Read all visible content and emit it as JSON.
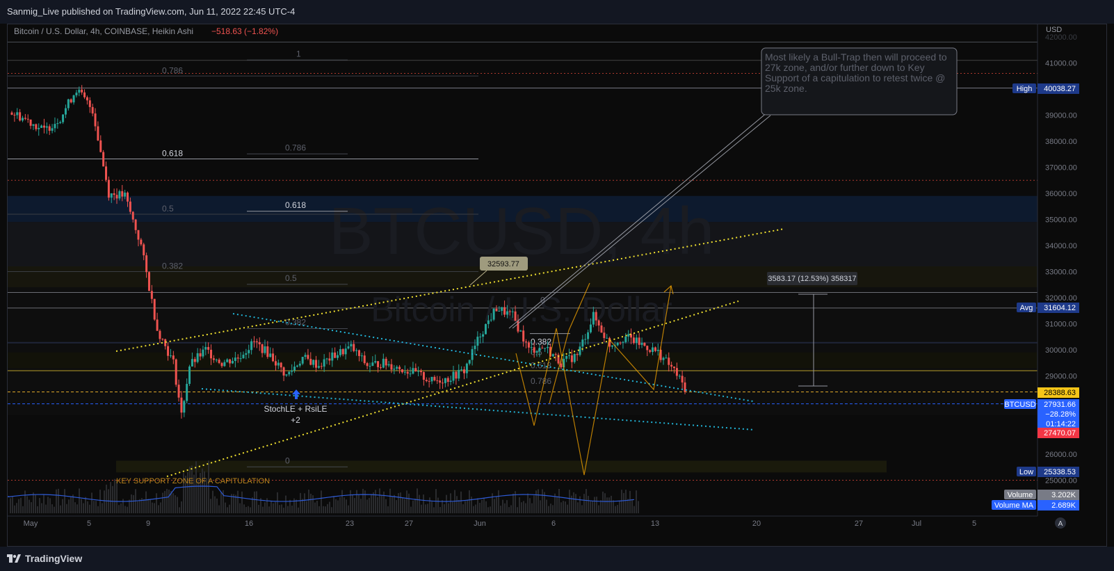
{
  "header": {
    "published": "Sanmig_Live published on TradingView.com, Jun 11, 2022 22:45 UTC-4"
  },
  "footer": {
    "brand": "TradingView"
  },
  "chart_data": {
    "type": "candlestick",
    "symbol_line": "Bitcoin / U.S. Dollar, 4h, COINBASE, Heikin Ashi",
    "change_text": "−518.63 (−1.82%)",
    "watermark": {
      "title": "BTCUSD, 4h",
      "subtitle": "Bitcoin / U.S. Dollar"
    },
    "currency": "USD",
    "ylim": [
      24500,
      42000
    ],
    "yticks": [
      25000,
      26000,
      27000,
      28000,
      29000,
      30000,
      31000,
      32000,
      33000,
      34000,
      35000,
      36000,
      37000,
      38000,
      39000,
      40000,
      41000,
      42000
    ],
    "ytick_labels": [
      "25000.00",
      "26000.00",
      "27000.00",
      "28000.00",
      "29000.00",
      "30000.00",
      "31000.00",
      "32000.00",
      "33000.00",
      "34000.00",
      "35000.00",
      "36000.00",
      "37000.00",
      "38000.00",
      "39000.00",
      "40000.00",
      "41000.00",
      "42000.00"
    ],
    "xticks": [
      {
        "label": "May",
        "day": 0
      },
      {
        "label": "5",
        "day": 4
      },
      {
        "label": "9",
        "day": 8
      },
      {
        "label": "16",
        "day": 15
      },
      {
        "label": "23",
        "day": 22
      },
      {
        "label": "27",
        "day": 26
      },
      {
        "label": "Jun",
        "day": 31
      },
      {
        "label": "6",
        "day": 36
      },
      {
        "label": "13",
        "day": 43
      },
      {
        "label": "20",
        "day": 50
      },
      {
        "label": "27",
        "day": 57
      },
      {
        "label": "Jul",
        "day": 61
      },
      {
        "label": "5",
        "day": 65
      }
    ],
    "price_points": [
      [
        0,
        39100
      ],
      [
        1,
        38800
      ],
      [
        2,
        38400
      ],
      [
        3,
        38900
      ],
      [
        4,
        40000
      ],
      [
        5,
        39200
      ],
      [
        6,
        36000
      ],
      [
        7,
        35900
      ],
      [
        8,
        34000
      ],
      [
        9,
        30800
      ],
      [
        10,
        29500
      ],
      [
        10.5,
        27500
      ],
      [
        11,
        29400
      ],
      [
        12,
        30000
      ],
      [
        13,
        29500
      ],
      [
        14,
        29700
      ],
      [
        15,
        30300
      ],
      [
        16,
        29800
      ],
      [
        17,
        29000
      ],
      [
        18,
        29700
      ],
      [
        19,
        29400
      ],
      [
        20,
        29800
      ],
      [
        21,
        30100
      ],
      [
        22,
        29400
      ],
      [
        23,
        29500
      ],
      [
        24,
        29300
      ],
      [
        25,
        29100
      ],
      [
        26,
        28800
      ],
      [
        27,
        28900
      ],
      [
        28,
        29200
      ],
      [
        29,
        30600
      ],
      [
        30,
        31600
      ],
      [
        31,
        31300
      ],
      [
        32,
        30000
      ],
      [
        33,
        30100
      ],
      [
        34,
        29500
      ],
      [
        35,
        29800
      ],
      [
        36,
        31300
      ],
      [
        37,
        30200
      ],
      [
        38,
        30500
      ],
      [
        39,
        30200
      ],
      [
        40,
        29900
      ],
      [
        41,
        29200
      ],
      [
        41.8,
        28400
      ]
    ],
    "price_labels": [
      {
        "name": "High",
        "text": "40038.27",
        "value": 40038.27,
        "bg": "#1e3a8a"
      },
      {
        "name": "Avg",
        "text": "31604.12",
        "value": 31604.12,
        "bg": "#1e3a8a"
      },
      {
        "name": "",
        "text": "28388.63",
        "value": 28388.63,
        "bg": "#f5c518",
        "fg": "#000000"
      },
      {
        "name": "BTCUSD",
        "text": "27931.66",
        "extra": [
          "−28.28%",
          "01:14:22"
        ],
        "value": 27931.66,
        "bg": "#2962ff"
      },
      {
        "name": "",
        "text": "27470.07",
        "value": 27470.07,
        "bg": "#f23645"
      },
      {
        "name": "Low",
        "text": "25338.53",
        "value": 25338.53,
        "bg": "#1e3a8a"
      },
      {
        "name": "Volume",
        "text": "3.202K",
        "bg": "#787b86"
      },
      {
        "name": "Volume MA",
        "text": "2.689K",
        "bg": "#2962ff"
      }
    ],
    "fib_left_labels": [
      "0.786",
      "0.618",
      "0.5",
      "0.382"
    ],
    "fib_mid_labels": [
      "1",
      "0.786",
      "0.618",
      "0.5",
      "0.382",
      "0"
    ],
    "fib_right_labels": [
      "0",
      "0.382",
      "0.5",
      "0.618",
      "0.786"
    ],
    "annotations": {
      "callout": "Most likely a Bull-Trap then will proceed to 27k zone, and/or further down to Key Support of a capitulation to retest twice @ 25k zone.",
      "price_tag": "32593.77",
      "range_label": "3583.17 (12.53%) 358317",
      "signal": "StochLE + RsiLE",
      "signal_count": "+2",
      "support_zone": "KEY SUPPORT ZONE OF A  CAPITULATION",
      "axis_badge": "A"
    },
    "colors": {
      "up": "#26a69a",
      "down": "#ef5350",
      "yellow_trend": "#f2e230",
      "cyan_trend": "#22b5d8",
      "callout_border": "#9598a1",
      "zone": "#f7a600"
    }
  }
}
